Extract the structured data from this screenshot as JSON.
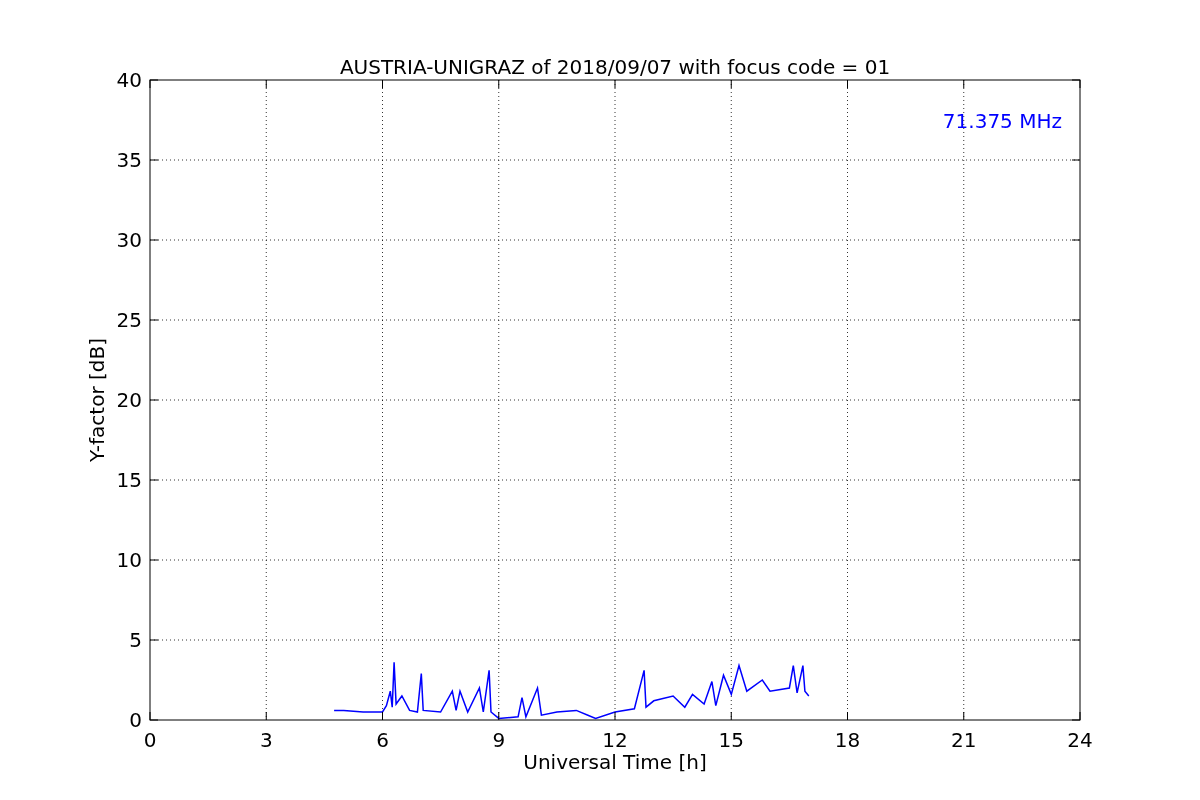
{
  "figure": {
    "chart_data": {
      "type": "line",
      "title": "AUSTRIA-UNIGRAZ of 2018/09/07 with focus code = 01",
      "xlabel": "Universal Time [h]",
      "ylabel": "Y-factor [dB]",
      "x": [
        4.75,
        5.0,
        5.5,
        6.0,
        6.1,
        6.2,
        6.25,
        6.3,
        6.35,
        6.5,
        6.7,
        6.9,
        7.0,
        7.05,
        7.5,
        7.8,
        7.9,
        8.0,
        8.2,
        8.5,
        8.6,
        8.75,
        8.8,
        9.0,
        9.5,
        9.6,
        9.7,
        10.0,
        10.1,
        10.5,
        11.0,
        11.3,
        11.5,
        12.0,
        12.5,
        12.75,
        12.8,
        13.0,
        13.5,
        13.8,
        14.0,
        14.3,
        14.5,
        14.6,
        14.8,
        15.0,
        15.2,
        15.4,
        15.8,
        16.0,
        16.5,
        16.6,
        16.7,
        16.85,
        16.9,
        17.0
      ],
      "series": [
        {
          "color": "#0000ff",
          "values": [
            0.6,
            0.6,
            0.5,
            0.5,
            0.9,
            1.8,
            0.8,
            3.6,
            1.0,
            1.5,
            0.6,
            0.5,
            2.9,
            0.6,
            0.5,
            1.8,
            0.6,
            1.8,
            0.5,
            2.0,
            0.5,
            3.1,
            0.5,
            0.1,
            0.2,
            1.4,
            0.2,
            2.0,
            0.3,
            0.5,
            0.6,
            0.3,
            0.1,
            0.5,
            0.7,
            3.1,
            0.8,
            1.2,
            1.5,
            0.8,
            1.6,
            1.0,
            2.4,
            0.9,
            2.8,
            1.6,
            3.4,
            1.8,
            2.5,
            1.8,
            2.0,
            3.4,
            1.7,
            3.4,
            1.8,
            1.5
          ]
        }
      ],
      "xlim": [
        0,
        24
      ],
      "ylim": [
        0,
        40
      ],
      "xticks": [
        0,
        3,
        6,
        9,
        12,
        15,
        18,
        21,
        24
      ],
      "yticks": [
        0,
        5,
        10,
        15,
        20,
        25,
        30,
        35,
        40
      ],
      "grid": true,
      "annotations": [
        {
          "text": "71.375 MHz"
        }
      ]
    }
  }
}
